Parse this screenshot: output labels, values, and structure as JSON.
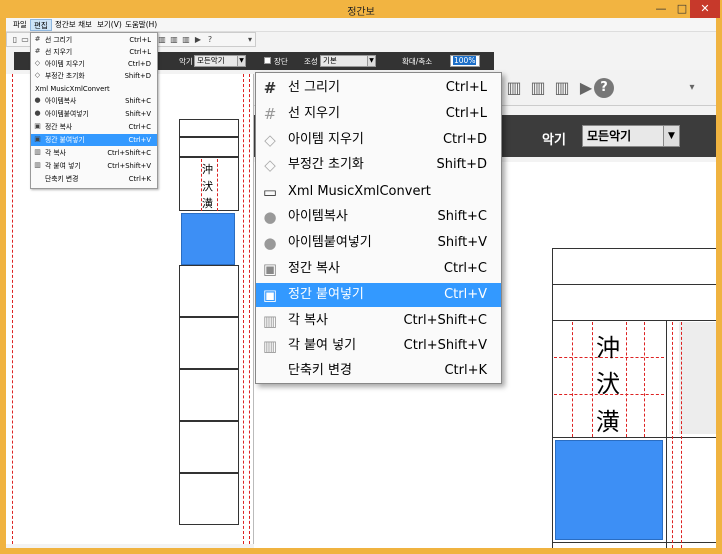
{
  "window": {
    "title": "정간보",
    "min_glyph": "—",
    "max_glyph": "□",
    "close_glyph": "✕"
  },
  "menubar": {
    "items": [
      "파일",
      "편집",
      "정간보 채보",
      "보기(V)",
      "도움말(H)"
    ]
  },
  "darkbar": {
    "instrument_label": "악기",
    "instrument_value": "모든악기",
    "jangdan_label": "장단",
    "key_label": "조성",
    "key_value": "기본",
    "zoom_label": "확대/축소",
    "zoom_value": "100%"
  },
  "edit_menu": {
    "items": [
      {
        "icon": "hash-icon",
        "glyph": "#",
        "label": "선 그리기",
        "shortcut": "Ctrl+L"
      },
      {
        "icon": "hash-erase-icon",
        "glyph": "#",
        "label": "선 지우기",
        "shortcut": "Ctrl+L"
      },
      {
        "icon": "eraser-icon",
        "glyph": "◇",
        "label": "아이템 지우기",
        "shortcut": "Ctrl+D"
      },
      {
        "icon": "eraser-icon",
        "glyph": "◇",
        "label": "부정간 초기화",
        "shortcut": "Shift+D"
      },
      {
        "icon": "xml-icon",
        "glyph": "▭",
        "label": "Xml MusicXmlConvert",
        "shortcut": ""
      },
      {
        "icon": "copy-item-icon",
        "glyph": "●",
        "label": "아이템복사",
        "shortcut": "Shift+C"
      },
      {
        "icon": "paste-item-icon",
        "glyph": "●",
        "label": "아이템붙여넣기",
        "shortcut": "Shift+V"
      },
      {
        "icon": "copy-cell-icon",
        "glyph": "▣",
        "label": "정간 복사",
        "shortcut": "Ctrl+C"
      },
      {
        "icon": "paste-cell-icon",
        "glyph": "▣",
        "label": "정간 붙여넣기",
        "shortcut": "Ctrl+V"
      },
      {
        "icon": "copy-gak-icon",
        "glyph": "▥",
        "label": "각 복사",
        "shortcut": "Ctrl+Shift+C"
      },
      {
        "icon": "paste-gak-icon",
        "glyph": "▥",
        "label": "각 붙여 넣기",
        "shortcut": "Ctrl+Shift+V"
      },
      {
        "icon": "",
        "glyph": "",
        "label": "단축키 변경",
        "shortcut": "Ctrl+K"
      }
    ],
    "selected_index": 8
  },
  "score": {
    "hanja": [
      "沖",
      "汱",
      "潢"
    ]
  },
  "zoom_toolbar": {
    "help_glyph": "?"
  }
}
